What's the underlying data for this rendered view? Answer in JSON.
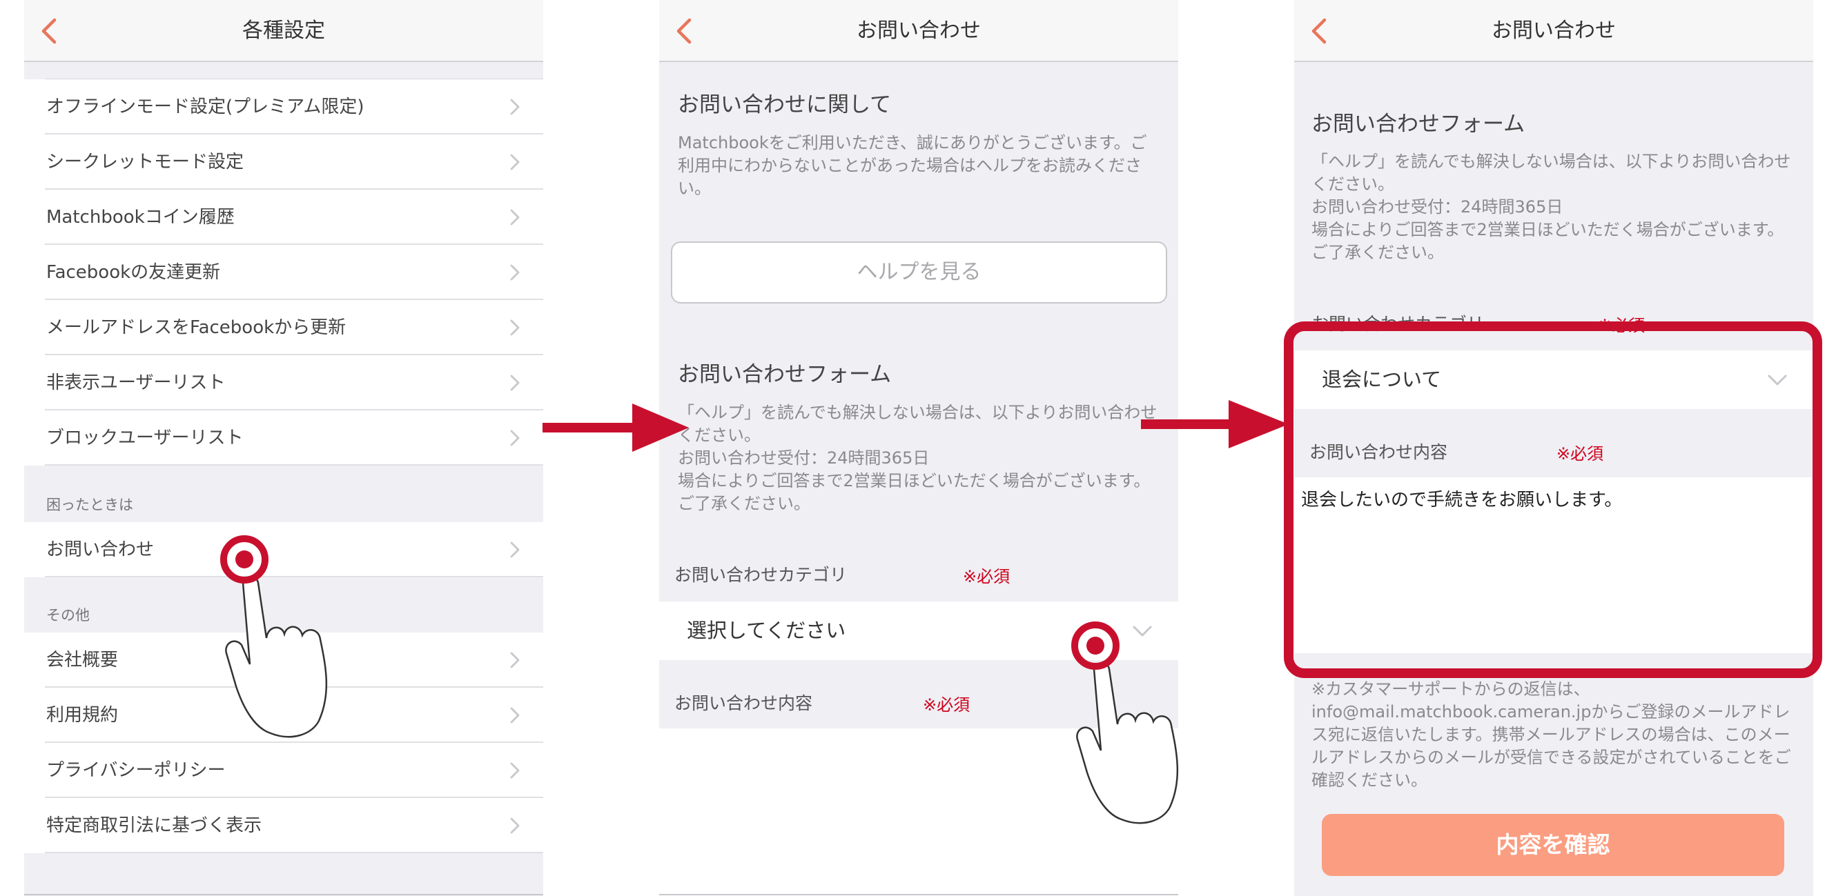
{
  "colors": {
    "accent": "#e8765c",
    "required": "#d0021b",
    "highlight": "#c8102e",
    "confirm_button": "#fb9d80"
  },
  "panel1": {
    "title": "各種設定",
    "items_top": [
      "オフラインモード設定(プレミアム限定)",
      "シークレットモード設定",
      "Matchbookコイン履歴",
      "Facebookの友達更新",
      "メールアドレスをFacebookから更新",
      "非表示ユーザーリスト",
      "ブロックユーザーリスト"
    ],
    "section_help": "困ったときは",
    "items_help": [
      "お問い合わせ"
    ],
    "section_other": "その他",
    "items_other": [
      "会社概要",
      "利用規約",
      "プライバシーポリシー",
      "特定商取引法に基づく表示"
    ]
  },
  "panel2": {
    "title": "お問い合わせ",
    "about_heading": "お問い合わせに関して",
    "about_text": "Matchbookをご利用いただき、誠にありがとうございます。ご利用中にわからないことがあった場合はヘルプをお読みください。",
    "help_button": "ヘルプを見る",
    "form_heading": "お問い合わせフォーム",
    "form_text": "「ヘルプ」を読んでも解決しない場合は、以下よりお問い合わせください。\nお問い合わせ受付：24時間365日\n場合によりご回答まで2営業日ほどいただく場合がございます。ご了承ください。",
    "category_label": "お問い合わせカテゴリ",
    "required": "※必須",
    "category_placeholder": "選択してください",
    "content_label": "お問い合わせ内容"
  },
  "panel3": {
    "title": "お問い合わせ",
    "form_heading": "お問い合わせフォーム",
    "form_text": "「ヘルプ」を読んでも解決しない場合は、以下よりお問い合わせください。\nお問い合わせ受付：24時間365日\n場合によりご回答まで2営業日ほどいただく場合がございます。ご了承ください。",
    "category_label": "お問い合わせカテゴリ",
    "required": "※必須",
    "category_value": "退会について",
    "content_label": "お問い合わせ内容",
    "content_value": "退会したいので手続きをお願いします。",
    "note": "※カスタマーサポートからの返信は、info@mail.matchbook.cameran.jpからご登録のメールアドレス宛に返信いたします。携帯メールアドレスの場合は、このメールアドレスからのメールが受信できる設定がされていることをご確認ください。",
    "confirm_button": "内容を確認"
  }
}
